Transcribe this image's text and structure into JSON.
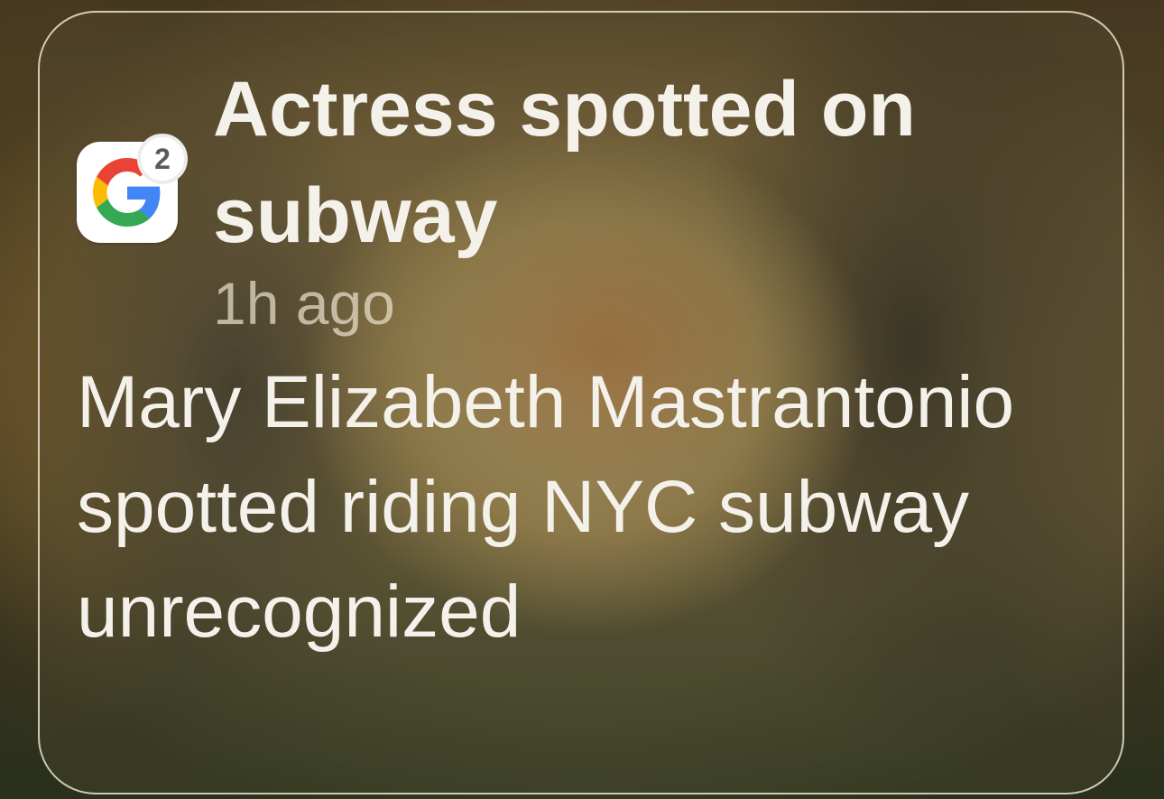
{
  "notification": {
    "app": {
      "icon": "google-g-icon",
      "badge_count": "2"
    },
    "title": "Actress spotted on subway",
    "timestamp": "1h ago",
    "body": "Mary Elizabeth Mastrantonio spotted riding NYC subway unrecognized"
  },
  "colors": {
    "google_blue": "#4285F4",
    "google_red": "#EA4335",
    "google_yellow": "#FBBC05",
    "google_green": "#34A853",
    "text_primary": "#f4f1ea"
  }
}
